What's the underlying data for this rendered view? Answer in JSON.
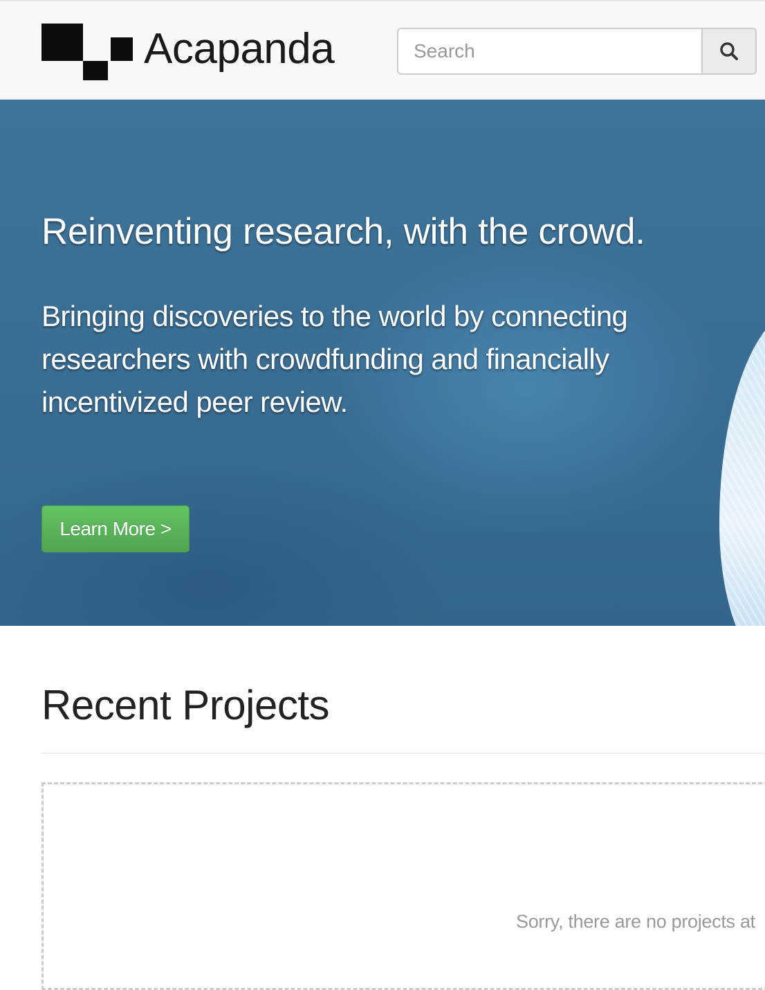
{
  "header": {
    "brand_name": "Acapanda",
    "search": {
      "placeholder": "Search",
      "value": ""
    },
    "search_icon": "magnifier-icon"
  },
  "hero": {
    "title": "Reinventing research, with the crowd.",
    "lead": "Bringing discoveries to the world by connecting researchers with crowdfunding and financially incentivized peer review.",
    "cta_label": "Learn More >"
  },
  "projects": {
    "section_title": "Recent Projects",
    "empty_message": "Sorry, there are no projects at"
  },
  "colors": {
    "hero_blue": "#3b6f95",
    "cta_green": "#5bb75b",
    "navbar_bg": "#f8f8f8"
  }
}
